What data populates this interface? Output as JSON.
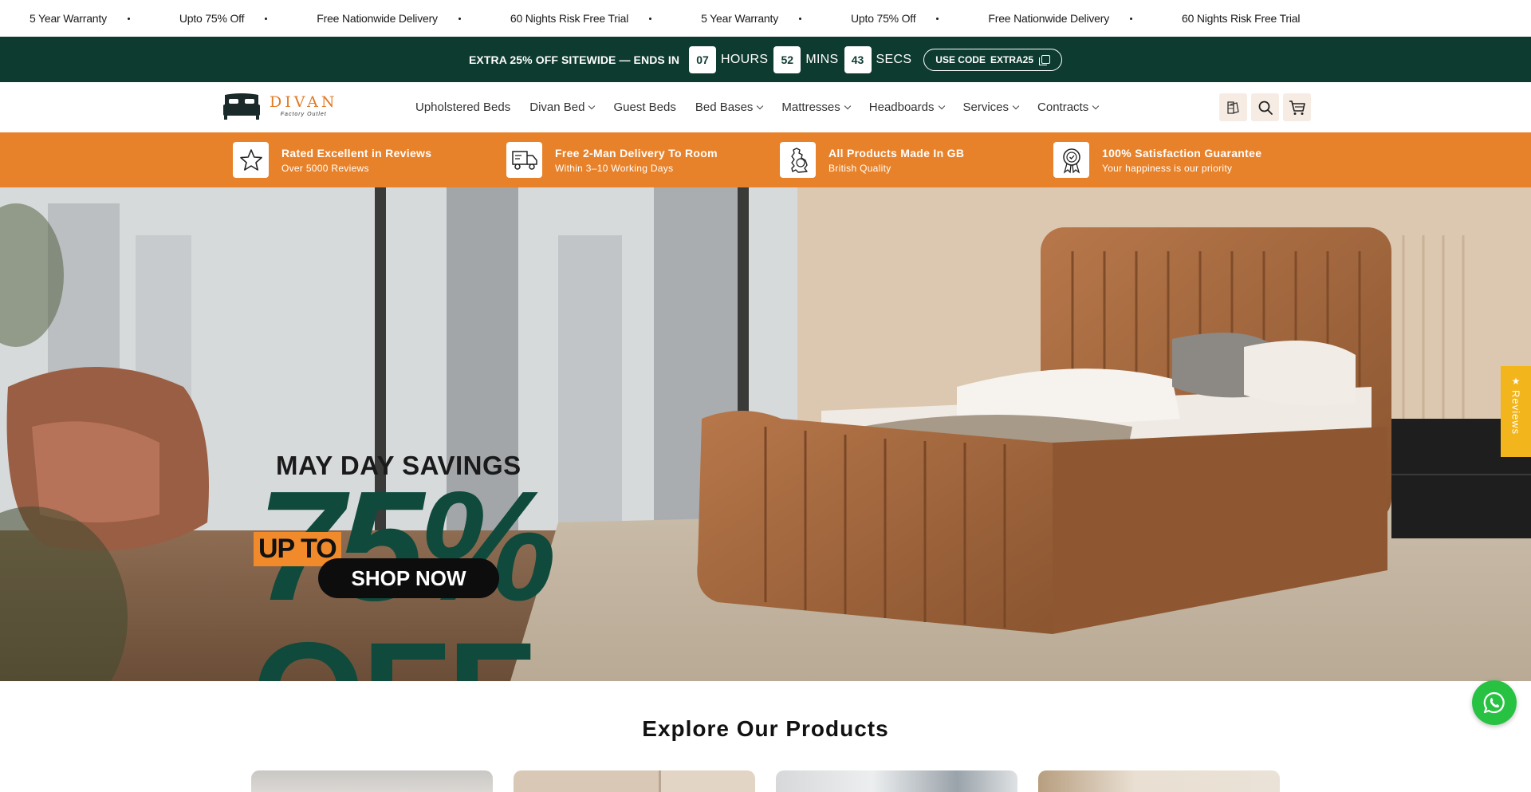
{
  "marquee": {
    "items": [
      "5 Year Warranty",
      "Upto 75% Off",
      "Free Nationwide Delivery",
      "60 Nights Risk Free Trial",
      "5 Year Warranty",
      "Upto 75% Off",
      "Free Nationwide Delivery",
      "60 Nights Risk Free Trial"
    ]
  },
  "promo": {
    "text": "EXTRA 25% OFF SITEWIDE — ENDS IN",
    "hours": "07",
    "hours_label": "HOURS",
    "mins": "52",
    "mins_label": "MINS",
    "secs": "43",
    "secs_label": "SECS",
    "code_prefix": "USE CODE",
    "code": "EXTRA25"
  },
  "header": {
    "logo_name": "DIVAN",
    "logo_sub": "Factory Outlet",
    "nav": [
      {
        "label": "Upholstered Beds",
        "dropdown": false
      },
      {
        "label": "Divan Bed",
        "dropdown": true
      },
      {
        "label": "Guest Beds",
        "dropdown": false
      },
      {
        "label": "Bed Bases",
        "dropdown": true
      },
      {
        "label": "Mattresses",
        "dropdown": true
      },
      {
        "label": "Headboards",
        "dropdown": true
      },
      {
        "label": "Services",
        "dropdown": true
      },
      {
        "label": "Contracts",
        "dropdown": true
      }
    ],
    "icons": [
      "fabric-swatch-icon",
      "search-icon",
      "cart-icon"
    ]
  },
  "usp": [
    {
      "title": "Rated Excellent in Reviews",
      "sub": "Over 5000 Reviews",
      "icon": "star-icon"
    },
    {
      "title": "Free 2-Man Delivery To Room",
      "sub": "Within 3–10 Working Days",
      "icon": "delivery-truck-icon"
    },
    {
      "title": "All Products Made In GB",
      "sub": "British Quality",
      "icon": "gb-map-icon"
    },
    {
      "title": "100% Satisfaction Guarantee",
      "sub": "Your happiness is our priority",
      "icon": "guarantee-badge-icon"
    }
  ],
  "hero": {
    "headline": "MAY DAY SAVINGS",
    "upto": "UP TO",
    "big": "75%",
    "off": "OFF",
    "cta": "SHOP NOW"
  },
  "reviews_tab": {
    "label": "Reviews",
    "icon": "star-icon"
  },
  "whatsapp": {
    "icon": "whatsapp-icon"
  },
  "explore": {
    "title": "Explore Our Products"
  },
  "colors": {
    "brand_green": "#0e3b30",
    "brand_orange": "#e8822a",
    "hero_green": "#0f4a3c",
    "reviews_yellow": "#f2b51b",
    "whatsapp_green": "#28c243"
  }
}
